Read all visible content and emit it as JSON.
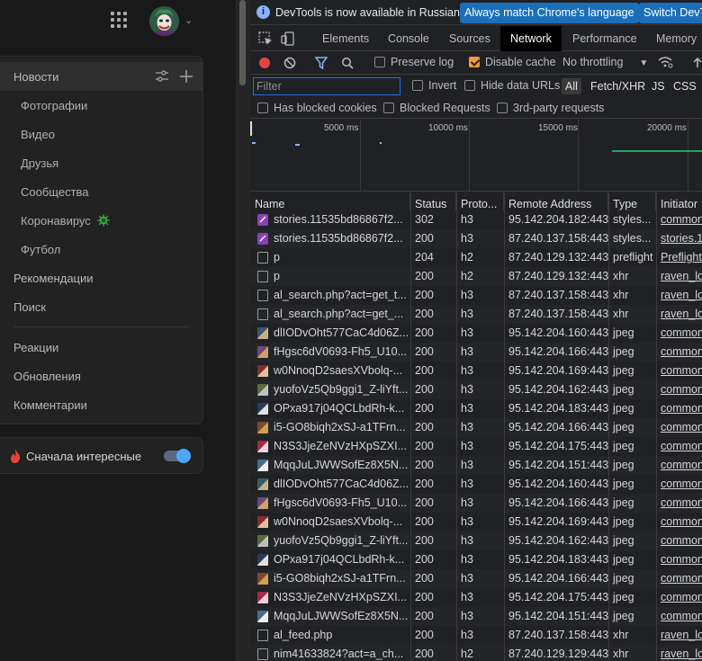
{
  "vk": {
    "menu": {
      "news_label": "Новости",
      "items": [
        {
          "label": "Фотографии"
        },
        {
          "label": "Видео"
        },
        {
          "label": "Друзья"
        },
        {
          "label": "Сообщества"
        },
        {
          "label": "Коронавирус"
        },
        {
          "label": "Футбол"
        }
      ],
      "top_items": [
        {
          "label": "Рекомендации"
        },
        {
          "label": "Поиск"
        }
      ],
      "bottom_items": [
        {
          "label": "Реакции"
        },
        {
          "label": "Обновления"
        },
        {
          "label": "Комментарии"
        }
      ]
    },
    "sort": {
      "label": "Сначала интересные",
      "enabled": true
    }
  },
  "devtools": {
    "infobar": {
      "message": "DevTools is now available in Russian!",
      "match_button": "Always match Chrome's language",
      "switch_button": "Switch DevT"
    },
    "tabs": [
      "Elements",
      "Console",
      "Sources",
      "Network",
      "Performance",
      "Memory"
    ],
    "active_tab": "Network",
    "toolbar": {
      "preserve_log": "Preserve log",
      "disable_cache": "Disable cache",
      "throttling": "No throttling"
    },
    "filter": {
      "placeholder": "Filter",
      "invert": "Invert",
      "hide_data_urls": "Hide data URLs",
      "types": [
        "All",
        "Fetch/XHR",
        "JS",
        "CSS"
      ],
      "selected_type": "All",
      "has_blocked_cookies": "Has blocked cookies",
      "blocked_requests": "Blocked Requests",
      "third_party": "3rd-party requests"
    },
    "overview": {
      "ticks": [
        "5000 ms",
        "10000 ms",
        "15000 ms",
        "20000 ms"
      ]
    },
    "columns": [
      "Name",
      "Status",
      "Proto...",
      "Remote Address",
      "Type",
      "Initiator"
    ],
    "rows": [
      {
        "name": "stories.11535bd86867f2...",
        "status": "302",
        "proto": "h3",
        "addr": "95.142.204.182:443",
        "type": "styles...",
        "init": "common",
        "icon": "css"
      },
      {
        "name": "stories.11535bd86867f2...",
        "status": "200",
        "proto": "h3",
        "addr": "87.240.137.158:443",
        "type": "styles...",
        "init": "stories.1",
        "icon": "css"
      },
      {
        "name": "p",
        "status": "204",
        "proto": "h2",
        "addr": "87.240.129.132:443",
        "type": "preflight",
        "init": "Preflight",
        "icon": "doc"
      },
      {
        "name": "p",
        "status": "200",
        "proto": "h2",
        "addr": "87.240.129.132:443",
        "type": "xhr",
        "init": "raven_lo",
        "icon": "doc"
      },
      {
        "name": "al_search.php?act=get_t...",
        "status": "200",
        "proto": "h3",
        "addr": "87.240.137.158:443",
        "type": "xhr",
        "init": "raven_lo",
        "icon": "doc"
      },
      {
        "name": "al_search.php?act=get_...",
        "status": "200",
        "proto": "h3",
        "addr": "87.240.137.158:443",
        "type": "xhr",
        "init": "raven_lo",
        "icon": "doc"
      },
      {
        "name": "dlIODvOht577CaC4d06Z...",
        "status": "200",
        "proto": "h3",
        "addr": "95.142.204.160:443",
        "type": "jpeg",
        "init": "common",
        "icon": "img1"
      },
      {
        "name": "fHgsc6dV0693-Fh5_U10...",
        "status": "200",
        "proto": "h3",
        "addr": "95.142.204.166:443",
        "type": "jpeg",
        "init": "common",
        "icon": "img2"
      },
      {
        "name": "w0NnoqD2saesXVbolq-...",
        "status": "200",
        "proto": "h3",
        "addr": "95.142.204.169:443",
        "type": "jpeg",
        "init": "common",
        "icon": "img3"
      },
      {
        "name": "yuofoVz5Qb9ggi1_Z-liYft...",
        "status": "200",
        "proto": "h3",
        "addr": "95.142.204.162:443",
        "type": "jpeg",
        "init": "common",
        "icon": "img4"
      },
      {
        "name": "OPxa917j04QCLbdRh-k...",
        "status": "200",
        "proto": "h3",
        "addr": "95.142.204.183:443",
        "type": "jpeg",
        "init": "common",
        "icon": "img5"
      },
      {
        "name": "i5-GO8biqh2xSJ-a1TFrn...",
        "status": "200",
        "proto": "h3",
        "addr": "95.142.204.166:443",
        "type": "jpeg",
        "init": "common",
        "icon": "img6"
      },
      {
        "name": "N3S3JjeZeNVzHXpSZXI...",
        "status": "200",
        "proto": "h3",
        "addr": "95.142.204.175:443",
        "type": "jpeg",
        "init": "common",
        "icon": "img7"
      },
      {
        "name": "MqqJuLJWWSofEz8X5N...",
        "status": "200",
        "proto": "h3",
        "addr": "95.142.204.151:443",
        "type": "jpeg",
        "init": "common",
        "icon": "img8"
      },
      {
        "name": "dlIODvOht577CaC4d06Z...",
        "status": "200",
        "proto": "h3",
        "addr": "95.142.204.160:443",
        "type": "jpeg",
        "init": "common",
        "icon": "img1"
      },
      {
        "name": "fHgsc6dV0693-Fh5_U10...",
        "status": "200",
        "proto": "h3",
        "addr": "95.142.204.166:443",
        "type": "jpeg",
        "init": "common",
        "icon": "img2"
      },
      {
        "name": "w0NnoqD2saesXVbolq-...",
        "status": "200",
        "proto": "h3",
        "addr": "95.142.204.169:443",
        "type": "jpeg",
        "init": "common",
        "icon": "img3"
      },
      {
        "name": "yuofoVz5Qb9ggi1_Z-liYft...",
        "status": "200",
        "proto": "h3",
        "addr": "95.142.204.162:443",
        "type": "jpeg",
        "init": "common",
        "icon": "img4"
      },
      {
        "name": "OPxa917j04QCLbdRh-k...",
        "status": "200",
        "proto": "h3",
        "addr": "95.142.204.183:443",
        "type": "jpeg",
        "init": "common",
        "icon": "img5"
      },
      {
        "name": "i5-GO8biqh2xSJ-a1TFrn...",
        "status": "200",
        "proto": "h3",
        "addr": "95.142.204.166:443",
        "type": "jpeg",
        "init": "common",
        "icon": "img6"
      },
      {
        "name": "N3S3JjeZeNVzHXpSZXI...",
        "status": "200",
        "proto": "h3",
        "addr": "95.142.204.175:443",
        "type": "jpeg",
        "init": "common",
        "icon": "img7"
      },
      {
        "name": "MqqJuLJWWSofEz8X5N...",
        "status": "200",
        "proto": "h3",
        "addr": "95.142.204.151:443",
        "type": "jpeg",
        "init": "common",
        "icon": "img8"
      },
      {
        "name": "al_feed.php",
        "status": "200",
        "proto": "h3",
        "addr": "87.240.137.158:443",
        "type": "xhr",
        "init": "raven_lo",
        "icon": "doc"
      },
      {
        "name": "nim41633824?act=a_ch...",
        "status": "200",
        "proto": "h2",
        "addr": "87.240.129.129:443",
        "type": "xhr",
        "init": "raven_lo",
        "icon": "doc"
      }
    ]
  },
  "colors": {
    "accent": "#1a6fba",
    "record": "#e64343",
    "active_tab_bg": "#000000",
    "toggle": "#4ea8f7"
  }
}
